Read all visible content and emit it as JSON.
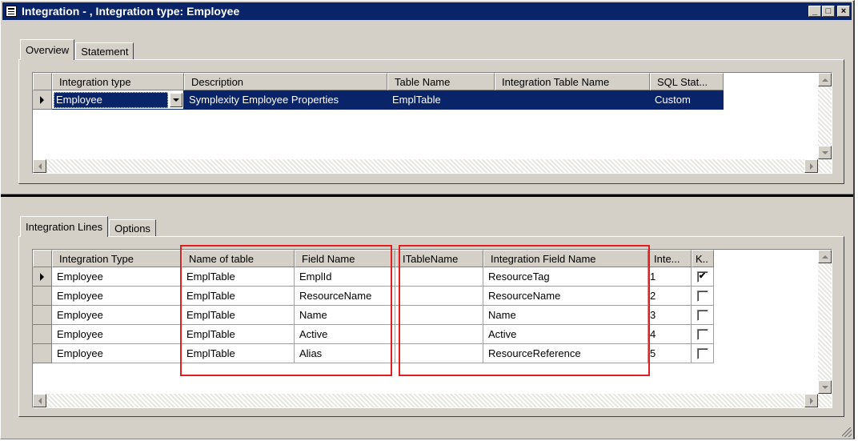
{
  "window": {
    "title": "Integration - , Integration type: Employee",
    "buttons": {
      "minimize": "_",
      "maximize": "□",
      "close": "×"
    }
  },
  "top_tabs": [
    {
      "label": "Overview",
      "active": true
    },
    {
      "label": "Statement",
      "active": false
    }
  ],
  "overview_grid": {
    "columns": [
      "Integration type",
      "Description",
      "Table Name",
      "Integration Table Name",
      "SQL Stat..."
    ],
    "rows": [
      [
        "Employee",
        "Symplexity Employee Properties",
        "EmplTable",
        "",
        "Custom"
      ]
    ]
  },
  "bottom_tabs": [
    {
      "label": "Integration Lines",
      "active": true
    },
    {
      "label": "Options",
      "active": false
    }
  ],
  "lines_grid": {
    "columns": [
      "Integration Type",
      "Name of table",
      "Field Name",
      "ITableName",
      "Integration Field Name",
      "Inte...",
      "K.."
    ],
    "rows": [
      {
        "cells": [
          "Employee",
          "EmplTable",
          "EmplId",
          "",
          "ResourceTag",
          "1"
        ],
        "checked": true
      },
      {
        "cells": [
          "Employee",
          "EmplTable",
          "ResourceName",
          "",
          "ResourceName",
          "2"
        ],
        "checked": false
      },
      {
        "cells": [
          "Employee",
          "EmplTable",
          "Name",
          "",
          "Name",
          "3"
        ],
        "checked": false
      },
      {
        "cells": [
          "Employee",
          "EmplTable",
          "Active",
          "",
          "Active",
          "4"
        ],
        "checked": false
      },
      {
        "cells": [
          "Employee",
          "EmplTable",
          "Alias",
          "",
          "ResourceReference",
          "5"
        ],
        "checked": false
      }
    ]
  },
  "icons": [
    "window-icon",
    "row-pointer-icon",
    "dropdown-arrow-icon",
    "checkmark-icon",
    "scroll-up-icon",
    "scroll-down-icon",
    "scroll-left-icon",
    "scroll-right-icon"
  ],
  "colors": {
    "selection": "#0a246a",
    "face": "#d4d0c8",
    "highlight_box": "#e02020"
  }
}
